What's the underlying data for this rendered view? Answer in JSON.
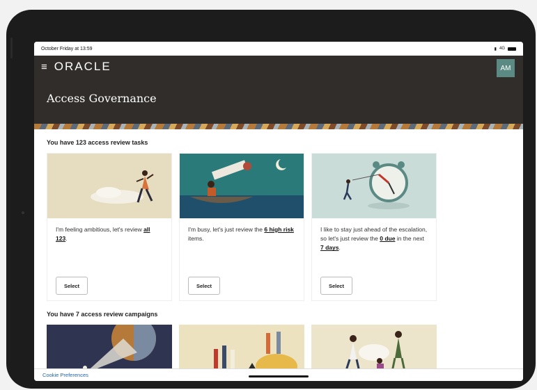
{
  "status": {
    "datetime": "October Friday at 13:59",
    "network": "4G"
  },
  "header": {
    "logo": "ORACLE",
    "avatar": "AM",
    "title": "Access Governance"
  },
  "tasks": {
    "heading": "You have 123 access review tasks",
    "cards": [
      {
        "pre": "I'm feeling ambitious, let's review ",
        "link1": "all 123",
        "mid": ".",
        "link2": "",
        "post": "",
        "button": "Select"
      },
      {
        "pre": "I'm busy, let's just review the ",
        "link1": "6 high risk",
        "mid": " items.",
        "link2": "",
        "post": "",
        "button": "Select"
      },
      {
        "pre": "I like to stay just ahead of the escalation, so let's just review the ",
        "link1": "0 due",
        "mid": " in the next ",
        "link2": "7 days",
        "post": ".",
        "button": "Select"
      }
    ]
  },
  "campaigns": {
    "heading": "You have 7 access review campaigns"
  },
  "footer": {
    "cookie": "Cookie Preferences"
  },
  "colors": {
    "header_bg": "#312d2a",
    "avatar_bg": "#5a8a83",
    "link": "#2266aa"
  }
}
